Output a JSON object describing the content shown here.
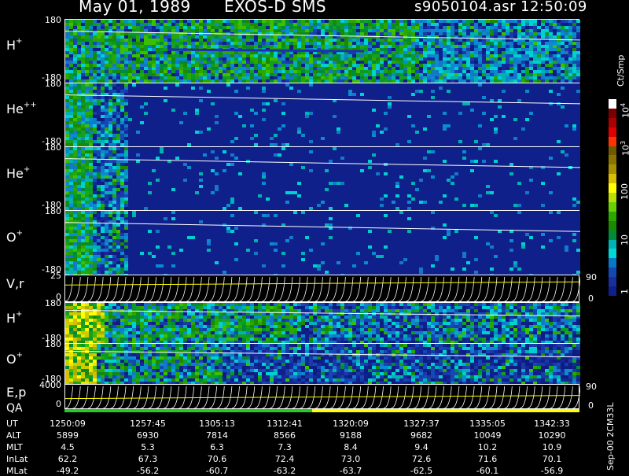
{
  "header": {
    "date": "May 01, 1989",
    "instrument": "EXOS-D SMS",
    "file": "s9050104.asr",
    "time": "12:50:09"
  },
  "colorbar": {
    "unit": "Ct/Smp",
    "ticks": [
      "10",
      "10",
      "100",
      "10",
      "1"
    ],
    "tick_sup": [
      "4",
      "3",
      "",
      "",
      ""
    ],
    "colors": [
      "#ffffff",
      "#7a0000",
      "#aa0000",
      "#e00000",
      "#ff3300",
      "#6e5a00",
      "#8a7400",
      "#a89000",
      "#d8c000",
      "#ffff00",
      "#b8e000",
      "#6ad000",
      "#2aa800",
      "#1a8a00",
      "#008a3a",
      "#00b2b2",
      "#00d8d8",
      "#0a78c8",
      "#1448b4",
      "#18309c",
      "#10208a"
    ]
  },
  "chart_data": {
    "type": "heatmap",
    "x_axis": {
      "label_rows": [
        "UT",
        "ALT",
        "MLT",
        "InLat",
        "MLat"
      ],
      "UT": [
        "1250:09",
        "1257:45",
        "1305:13",
        "1312:41",
        "1320:09",
        "1327:37",
        "1335:05",
        "1342:33"
      ],
      "ALT": [
        "5899",
        "6930",
        "7814",
        "8566",
        "9188",
        "9682",
        "10049",
        "10290"
      ],
      "MLT": [
        "4.5",
        "5.3",
        "6.3",
        "7.3",
        "8.4",
        "9.4",
        "10.2",
        "10.9"
      ],
      "InLat": [
        "62.2",
        "67.3",
        "70.6",
        "72.4",
        "73.0",
        "72.6",
        "71.6",
        "70.1"
      ],
      "MLat": [
        "-49.2",
        "-56.2",
        "-60.7",
        "-63.2",
        "-63.7",
        "-62.5",
        "-60.1",
        "-56.9"
      ]
    },
    "panels": [
      {
        "species": "H",
        "charge": "+",
        "y_top": "180",
        "y_bottom": "-180",
        "intensity_level": 0.62
      },
      {
        "species": "He",
        "charge": "++",
        "y_top": "180",
        "y_bottom": "-180",
        "intensity_level": 0.12
      },
      {
        "species": "He",
        "charge": "+",
        "y_top": "180",
        "y_bottom": "-180",
        "intensity_level": 0.18
      },
      {
        "species": "O",
        "charge": "+",
        "y_top": "180",
        "y_bottom": "-180",
        "intensity_level": 0.15
      },
      {
        "species": "V,r",
        "charge": "",
        "y_top": "25",
        "y_bottom": "0",
        "right_top": "90",
        "right_bottom": "0"
      },
      {
        "species": "H",
        "charge": "+",
        "y_top": "180",
        "y_bottom": "-180",
        "intensity_level": 0.45
      },
      {
        "species": "O",
        "charge": "+",
        "y_top": "180",
        "y_bottom": "-180",
        "intensity_level": 0.32
      },
      {
        "species": "E,p",
        "charge": "",
        "y_top": "4000",
        "y_bottom": "0",
        "right_top": "90",
        "right_bottom": "0"
      }
    ],
    "qa_label": "QA"
  },
  "footer_id": "Sep-00 2CM33L"
}
